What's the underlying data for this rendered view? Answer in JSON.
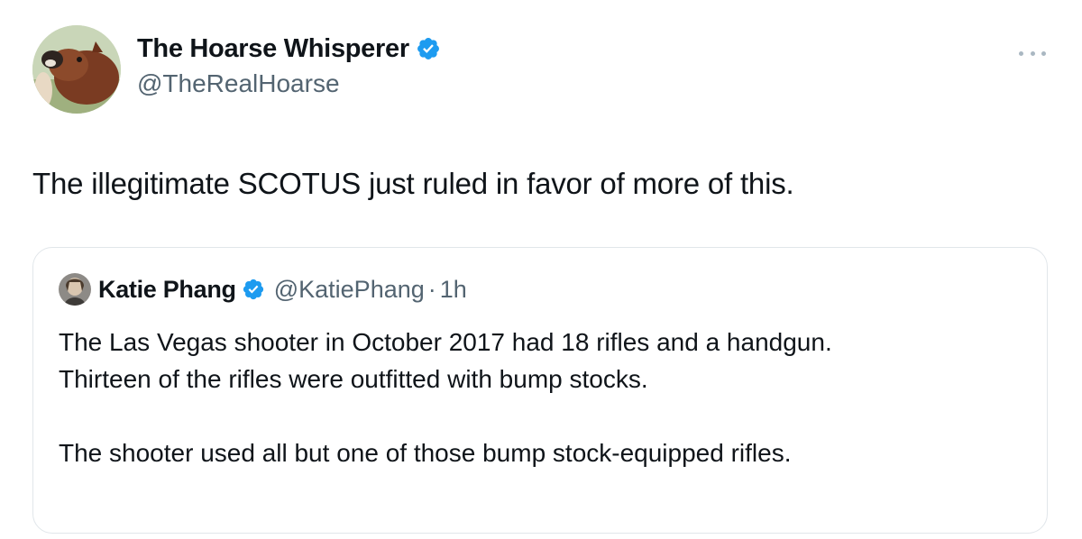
{
  "tweet": {
    "author": {
      "display_name": "The Hoarse Whisperer",
      "handle": "@TheRealHoarse",
      "verified": true,
      "avatar_icon": "horse-avatar"
    },
    "more_icon": "more-horizontal-icon",
    "text": "The illegitimate SCOTUS just ruled in favor of more of this."
  },
  "quoted_tweet": {
    "author": {
      "display_name": "Katie Phang",
      "handle": "@KatiePhang",
      "verified": true,
      "avatar_icon": "user-avatar"
    },
    "separator": "·",
    "time": "1h",
    "lines": [
      "The Las Vegas shooter in October 2017 had 18 rifles and a handgun.",
      "Thirteen of the rifles were outfitted with bump stocks.",
      "",
      "The shooter used all but one of those bump stock-equipped rifles."
    ]
  },
  "colors": {
    "verified_blue": "#1d9bf0",
    "secondary_text": "#536471",
    "border": "#e1e6ea"
  }
}
